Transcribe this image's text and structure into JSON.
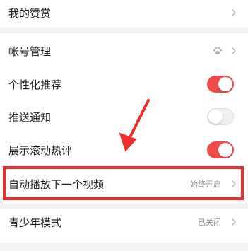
{
  "settings": {
    "my_tips": {
      "label": "我的赞赏"
    },
    "account": {
      "label": "帐号管理",
      "icon": "paw-icon"
    },
    "personalized": {
      "label": "个性化推荐",
      "enabled": true
    },
    "push": {
      "label": "推送通知",
      "enabled": false
    },
    "hot_comments": {
      "label": "展示滚动热评",
      "enabled": true
    },
    "autoplay": {
      "label": "自动播放下一个视频",
      "value": "始终开启"
    },
    "teen_mode": {
      "label": "青少年模式",
      "value": "已关闭"
    }
  },
  "colors": {
    "accent": "#f04b4b",
    "annotation": "#ee2d2d",
    "background": "#f4f4f4"
  }
}
